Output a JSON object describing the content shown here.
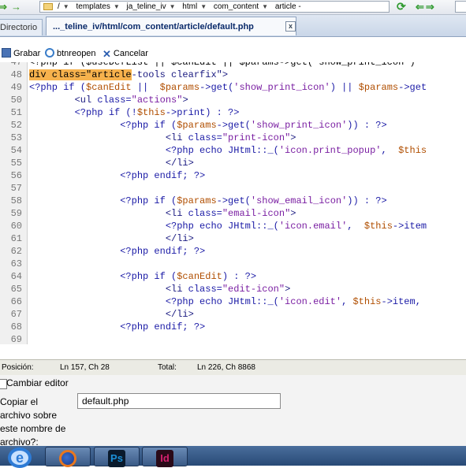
{
  "path_bar": {
    "crumbs": [
      "/",
      "templates",
      "ja_teline_iv",
      "html",
      "com_content",
      "article -"
    ]
  },
  "tabs": [
    {
      "label": "Directorio",
      "active": false
    },
    {
      "label": "..._teline_iv/html/com_content/article/default.php",
      "active": true,
      "close_glyph": "x"
    }
  ],
  "toolbar": {
    "save_label": "Grabar",
    "reopen_label": "btnreopen",
    "cancel_label": "Cancelar"
  },
  "code_lines": [
    {
      "num": "47",
      "segs": [
        {
          "c": "",
          "t": "<?php if ($useDefList || $canEdit || $params->get('show_print_icon')"
        }
      ]
    },
    {
      "num": "48",
      "segs": [
        {
          "c": "hl",
          "t": "div class=\"article"
        },
        {
          "c": "t",
          "t": "-tools clearfix\">"
        }
      ]
    },
    {
      "num": "49",
      "segs": [
        {
          "c": "k",
          "t": "<?php if ("
        },
        {
          "c": "v",
          "t": "$canEdit"
        },
        {
          "c": "k",
          "t": " ||  "
        },
        {
          "c": "v",
          "t": "$params"
        },
        {
          "c": "k",
          "t": "->get("
        },
        {
          "c": "s",
          "t": "'show_print_icon'"
        },
        {
          "c": "k",
          "t": ") || "
        },
        {
          "c": "v",
          "t": "$params"
        },
        {
          "c": "k",
          "t": "->get"
        }
      ]
    },
    {
      "num": "50",
      "segs": [
        {
          "c": "t",
          "t": "        <ul "
        },
        {
          "c": "k",
          "t": "class="
        },
        {
          "c": "s",
          "t": "\"actions\""
        },
        {
          "c": "t",
          "t": ">"
        }
      ]
    },
    {
      "num": "51",
      "segs": [
        {
          "c": "k",
          "t": "        <?php if (!"
        },
        {
          "c": "v",
          "t": "$this"
        },
        {
          "c": "k",
          "t": "->print) : ?>"
        }
      ]
    },
    {
      "num": "52",
      "segs": [
        {
          "c": "k",
          "t": "                <?php if ("
        },
        {
          "c": "v",
          "t": "$params"
        },
        {
          "c": "k",
          "t": "->get("
        },
        {
          "c": "s",
          "t": "'show_print_icon'"
        },
        {
          "c": "k",
          "t": ")) : ?>"
        }
      ]
    },
    {
      "num": "53",
      "segs": [
        {
          "c": "t",
          "t": "                        <li "
        },
        {
          "c": "k",
          "t": "class="
        },
        {
          "c": "s",
          "t": "\"print-icon\""
        },
        {
          "c": "t",
          "t": ">"
        }
      ]
    },
    {
      "num": "54",
      "segs": [
        {
          "c": "k",
          "t": "                        <?php echo JHtml::_("
        },
        {
          "c": "s",
          "t": "'icon.print_popup'"
        },
        {
          "c": "k",
          "t": ",  "
        },
        {
          "c": "v",
          "t": "$this"
        }
      ]
    },
    {
      "num": "55",
      "segs": [
        {
          "c": "t",
          "t": "                        </li>"
        }
      ]
    },
    {
      "num": "56",
      "segs": [
        {
          "c": "k",
          "t": "                <?php endif; ?>"
        }
      ]
    },
    {
      "num": "57",
      "segs": [
        {
          "c": "",
          "t": ""
        }
      ]
    },
    {
      "num": "58",
      "segs": [
        {
          "c": "k",
          "t": "                <?php if ("
        },
        {
          "c": "v",
          "t": "$params"
        },
        {
          "c": "k",
          "t": "->get("
        },
        {
          "c": "s",
          "t": "'show_email_icon'"
        },
        {
          "c": "k",
          "t": ")) : ?>"
        }
      ]
    },
    {
      "num": "59",
      "segs": [
        {
          "c": "t",
          "t": "                        <li "
        },
        {
          "c": "k",
          "t": "class="
        },
        {
          "c": "s",
          "t": "\"email-icon\""
        },
        {
          "c": "t",
          "t": ">"
        }
      ]
    },
    {
      "num": "60",
      "segs": [
        {
          "c": "k",
          "t": "                        <?php echo JHtml::_("
        },
        {
          "c": "s",
          "t": "'icon.email'"
        },
        {
          "c": "k",
          "t": ",  "
        },
        {
          "c": "v",
          "t": "$this"
        },
        {
          "c": "k",
          "t": "->item"
        }
      ]
    },
    {
      "num": "61",
      "segs": [
        {
          "c": "t",
          "t": "                        </li>"
        }
      ]
    },
    {
      "num": "62",
      "segs": [
        {
          "c": "k",
          "t": "                <?php endif; ?>"
        }
      ]
    },
    {
      "num": "63",
      "segs": [
        {
          "c": "",
          "t": ""
        }
      ]
    },
    {
      "num": "64",
      "segs": [
        {
          "c": "k",
          "t": "                <?php if ("
        },
        {
          "c": "v",
          "t": "$canEdit"
        },
        {
          "c": "k",
          "t": ") : ?>"
        }
      ]
    },
    {
      "num": "65",
      "segs": [
        {
          "c": "t",
          "t": "                        <li "
        },
        {
          "c": "k",
          "t": "class="
        },
        {
          "c": "s",
          "t": "\"edit-icon\""
        },
        {
          "c": "t",
          "t": ">"
        }
      ]
    },
    {
      "num": "66",
      "segs": [
        {
          "c": "k",
          "t": "                        <?php echo JHtml::_("
        },
        {
          "c": "s",
          "t": "'icon.edit'"
        },
        {
          "c": "k",
          "t": ", "
        },
        {
          "c": "v",
          "t": "$this"
        },
        {
          "c": "k",
          "t": "->item,"
        }
      ]
    },
    {
      "num": "67",
      "segs": [
        {
          "c": "t",
          "t": "                        </li>"
        }
      ]
    },
    {
      "num": "68",
      "segs": [
        {
          "c": "k",
          "t": "                <?php endif; ?>"
        }
      ]
    },
    {
      "num": "69",
      "segs": [
        {
          "c": "",
          "t": ""
        }
      ]
    }
  ],
  "status": {
    "position_label": "Posición:",
    "position_value": "Ln 157, Ch 28",
    "total_label": "Total:",
    "total_value": "Ln 226, Ch 8868"
  },
  "panel": {
    "change_editor_label": "Cambiar editor",
    "copy_question": "Copiar el\narchivo sobre\neste nombre de\narchivo?:",
    "filename_value": "default.php"
  },
  "taskbar": {
    "apps": [
      {
        "name": "internet-explorer",
        "glyph": "e"
      },
      {
        "name": "firefox",
        "glyph": ""
      },
      {
        "name": "photoshop",
        "glyph": "Ps",
        "color": "#1c8fd6"
      },
      {
        "name": "indesign",
        "glyph": "Id",
        "color": "#d6206f"
      }
    ]
  }
}
